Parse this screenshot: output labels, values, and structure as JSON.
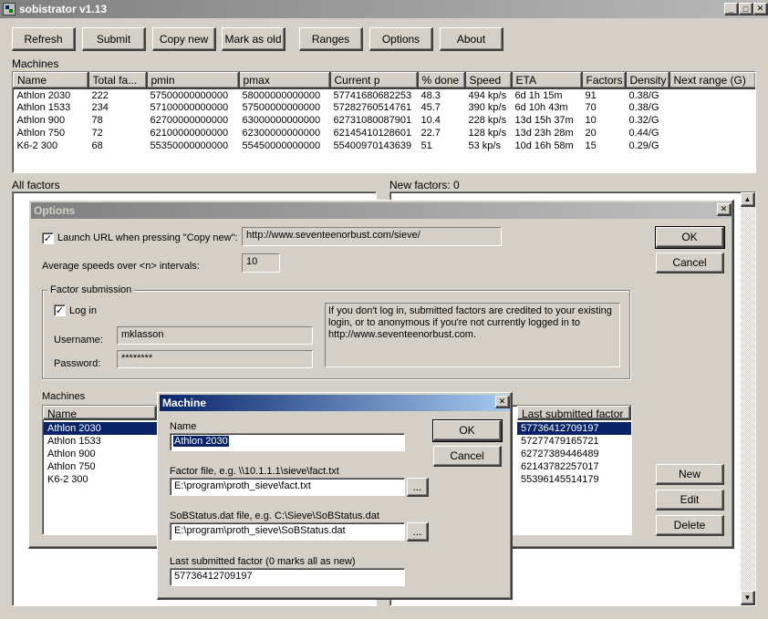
{
  "app": {
    "title": "sobistrator v1.13"
  },
  "toolbar": {
    "refresh": "Refresh",
    "submit": "Submit",
    "copy_new": "Copy new",
    "mark_old": "Mark as old",
    "ranges": "Ranges",
    "options": "Options",
    "about": "About"
  },
  "machines_section": {
    "label": "Machines",
    "columns": [
      "Name",
      "Total fa...",
      "pmin",
      "pmax",
      "Current p",
      "% done",
      "Speed",
      "ETA",
      "Factors",
      "Density",
      "Next range (G)"
    ],
    "rows": [
      [
        "Athlon 2030",
        "222",
        "57500000000000",
        "58000000000000",
        "57741680682253",
        "48.3",
        "494 kp/s",
        "6d 1h 15m",
        "91",
        "0.38/G",
        ""
      ],
      [
        "Athlon 1533",
        "234",
        "57100000000000",
        "57500000000000",
        "57282760514761",
        "45.7",
        "390 kp/s",
        "6d 10h 43m",
        "70",
        "0.38/G",
        ""
      ],
      [
        "Athlon 900",
        "78",
        "62700000000000",
        "63000000000000",
        "62731080087901",
        "10.4",
        "228 kp/s",
        "13d 15h 37m",
        "10",
        "0.32/G",
        ""
      ],
      [
        "Athlon 750",
        "72",
        "62100000000000",
        "62300000000000",
        "62145410128601",
        "22.7",
        "128 kp/s",
        "13d 23h 28m",
        "20",
        "0.44/G",
        ""
      ],
      [
        "K6-2 300",
        "68",
        "55350000000000",
        "55450000000000",
        "55400970143639",
        "51",
        "53 kp/s",
        "10d 16h 58m",
        "15",
        "0.29/G",
        ""
      ]
    ]
  },
  "all_factors": {
    "label": "All factors"
  },
  "new_factors": {
    "label": "New factors: 0"
  },
  "options_dialog": {
    "title": "Options",
    "launch_url_label": "Launch URL when pressing \"Copy new\":",
    "launch_url_checked": true,
    "launch_url_value": "http://www.seventeenorbust.com/sieve/",
    "avg_speeds_label": "Average speeds over <n> intervals:",
    "avg_speeds_value": "10",
    "ok": "OK",
    "cancel": "Cancel",
    "factor_submission": {
      "legend": "Factor submission",
      "login_label": "Log in",
      "login_checked": true,
      "username_label": "Username:",
      "username_value": "mklasson",
      "password_label": "Password:",
      "password_value": "********",
      "note": "If you don't log in, submitted factors are credited to your existing login, or to anonymous if you're not currently logged in to http://www.seventeenorbust.com."
    },
    "machines": {
      "label": "Machines",
      "name_header": "Name",
      "last_header": "Last submitted factor",
      "names": [
        "Athlon 2030",
        "Athlon 1533",
        "Athlon 900",
        "Athlon 750",
        "K6-2 300"
      ],
      "last_factors": [
        "57736412709197",
        "57277479165721",
        "62727389446489",
        "62143782257017",
        "55396145514179"
      ],
      "selected_index": 0
    },
    "new": "New",
    "edit": "Edit",
    "delete": "Delete"
  },
  "machine_dialog": {
    "title": "Machine",
    "name_label": "Name",
    "name_value": "Athlon 2030",
    "factor_file_label": "Factor file, e.g. \\\\10.1.1.1\\sieve\\fact.txt",
    "factor_file_value": "E:\\program\\proth_sieve\\fact.txt",
    "sob_file_label": "SoBStatus.dat file, e.g. C:\\Sieve\\SoBStatus.dat",
    "sob_file_value": "E:\\program\\proth_sieve\\SoBStatus.dat",
    "last_label": "Last submitted factor (0 marks all as new)",
    "last_value": "57736412709197",
    "browse": "...",
    "ok": "OK",
    "cancel": "Cancel"
  },
  "colors": {
    "face": "#d4d0c8",
    "selection": "#0a246a",
    "title_active": "#0a246a"
  }
}
